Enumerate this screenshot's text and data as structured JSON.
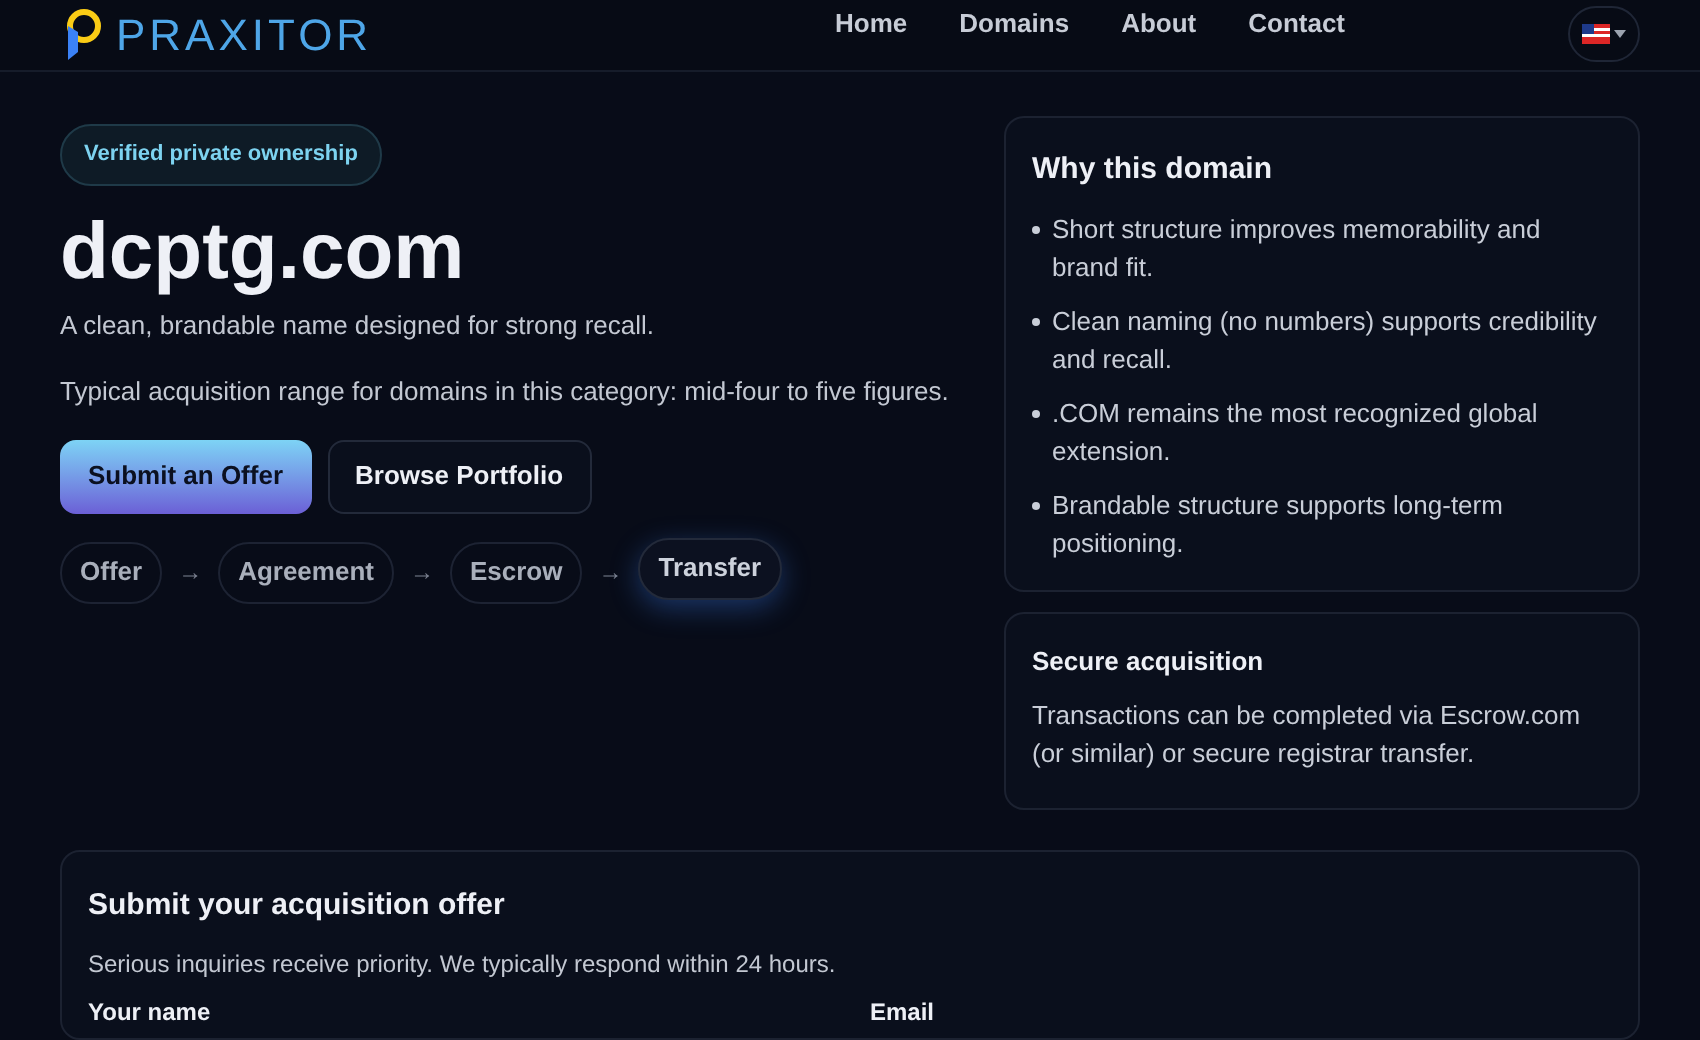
{
  "header": {
    "brand": "PRAXITOR",
    "nav": [
      {
        "label": "Home"
      },
      {
        "label": "Domains"
      },
      {
        "label": "About"
      },
      {
        "label": "Contact"
      }
    ]
  },
  "hero": {
    "badge": "Verified private ownership",
    "domain": "dcptg.com",
    "tagline": "A clean, brandable name designed for strong recall.",
    "range": "Typical acquisition range for domains in this category: mid-four to five figures.",
    "buttons": [
      {
        "label": "Submit an Offer",
        "kind": "primary"
      },
      {
        "label": "Browse Portfolio",
        "kind": "secondary"
      }
    ],
    "steps": [
      {
        "label": "Offer",
        "selected": false
      },
      {
        "label": "Agreement",
        "selected": false
      },
      {
        "label": "Escrow",
        "selected": false
      },
      {
        "label": "Transfer",
        "selected": true
      }
    ],
    "arrow": "→"
  },
  "why": {
    "title": "Why this domain",
    "points": [
      "Short structure improves memorability and brand fit.",
      "Clean naming (no numbers) supports credibility and recall.",
      ".COM remains the most recognized global extension.",
      "Brandable structure supports long-term positioning."
    ]
  },
  "secure": {
    "title": "Secure acquisition",
    "text": "Transactions can be completed via Escrow.com (or similar) or secure registrar transfer."
  },
  "offer_form": {
    "title": "Submit your acquisition offer",
    "subtitle": "Serious inquiries receive priority. We typically respond within 24 hours.",
    "fields": [
      {
        "label": "Your name"
      },
      {
        "label": "Email"
      }
    ]
  }
}
